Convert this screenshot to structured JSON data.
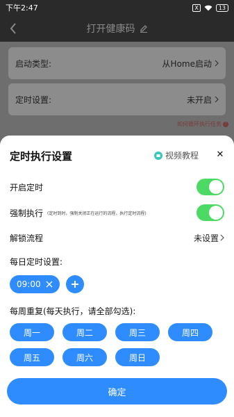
{
  "status_bar": {
    "time": "下午2:47",
    "sim_label": "X",
    "battery": "13"
  },
  "header": {
    "title": "打开健康码",
    "back_icon": "chevron-left-icon",
    "edit_icon": "pencil-icon"
  },
  "background": {
    "launch_type_label": "启动类型:",
    "launch_type_value": "从Home启动",
    "timer_label": "定时设置:",
    "timer_value": "未开启",
    "help_link": "如何循环执行任务"
  },
  "sheet": {
    "title": "定时执行设置",
    "video_link": "视频教程",
    "close_symbol": "✕",
    "enable_timer_label": "开启定时",
    "enable_timer_on": true,
    "force_exec_label": "强制执行",
    "force_exec_note": "(定时到时，强制关闭正在运行的流程，执行定时流程)",
    "force_exec_on": true,
    "unlock_label": "解锁流程",
    "unlock_value": "未设置",
    "daily_label": "每日定时设置:",
    "time_chip": "09:00",
    "weekly_label": "每周重复(每天执行，请全部勾选):",
    "days": [
      "周一",
      "周二",
      "周三",
      "周四",
      "周五",
      "周六",
      "周日"
    ],
    "confirm_label": "确定"
  },
  "colors": {
    "accent": "#2f8cff",
    "toggle_on": "#4cd964"
  }
}
